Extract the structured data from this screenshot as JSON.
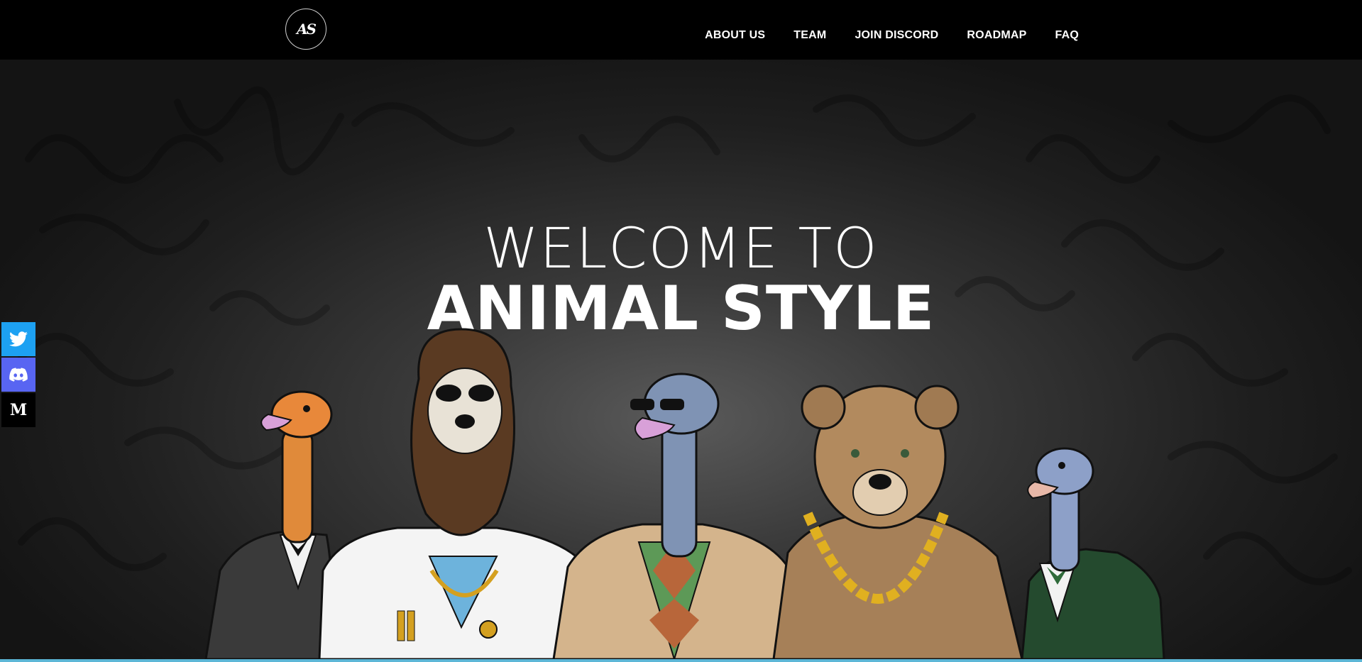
{
  "header": {
    "logo_text": "AS",
    "nav": [
      {
        "label": "ABOUT US"
      },
      {
        "label": "TEAM"
      },
      {
        "label": "JOIN DISCORD"
      },
      {
        "label": "ROADMAP"
      },
      {
        "label": "FAQ"
      }
    ]
  },
  "hero": {
    "welcome": "WELCOME TO",
    "brand": "ANIMAL STYLE"
  },
  "social": {
    "twitter_icon": "twitter-icon",
    "discord_icon": "discord-icon",
    "medium_label": "M"
  },
  "colors": {
    "accent_strip": "#5cb6d6",
    "twitter": "#1da1f2",
    "discord": "#5865f2"
  }
}
